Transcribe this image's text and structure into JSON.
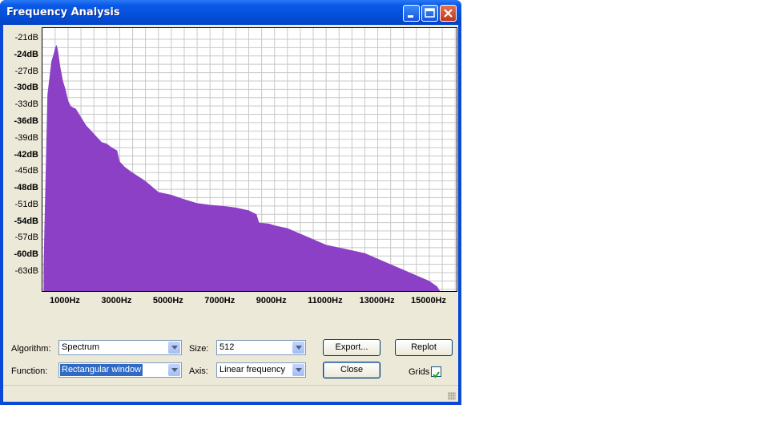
{
  "window": {
    "title": "Frequency Analysis"
  },
  "chart_data": {
    "type": "area",
    "color": "#8b40c6",
    "xlabel_ticks": [
      "1000Hz",
      "3000Hz",
      "5000Hz",
      "7000Hz",
      "9000Hz",
      "11000Hz",
      "13000Hz",
      "15000Hz"
    ],
    "ylabel_ticks": [
      "-21dB",
      "-24dB",
      "-27dB",
      "-30dB",
      "-33dB",
      "-36dB",
      "-39dB",
      "-42dB",
      "-45dB",
      "-48dB",
      "-51dB",
      "-54dB",
      "-57dB",
      "-60dB",
      "-63dB"
    ],
    "x_range_hz": [
      0,
      16000
    ],
    "y_range_db": [
      -67,
      -20
    ],
    "grid": true,
    "x": [
      50,
      200,
      350,
      450,
      500,
      550,
      600,
      700,
      800,
      900,
      1000,
      1100,
      1200,
      1300,
      1500,
      1700,
      1900,
      2100,
      2300,
      2500,
      2700,
      2900,
      3000,
      3200,
      3500,
      4000,
      4500,
      5000,
      5500,
      6000,
      6500,
      7000,
      7500,
      8000,
      8300,
      8400,
      8800,
      9000,
      9500,
      10000,
      10500,
      11000,
      11500,
      12000,
      12500,
      13000,
      13500,
      14000,
      14500,
      15000,
      15300,
      15500
    ],
    "y": [
      -62,
      -31,
      -25,
      -23.5,
      -22.5,
      -22,
      -22.8,
      -26,
      -28.5,
      -30,
      -32,
      -33,
      -33.3,
      -33.5,
      -35,
      -36.5,
      -37.5,
      -38.5,
      -39.5,
      -39.8,
      -40.5,
      -41,
      -43,
      -44,
      -45,
      -46.5,
      -48.5,
      -49,
      -49.8,
      -50.5,
      -50.8,
      -51,
      -51.3,
      -51.8,
      -52.5,
      -54,
      -54.2,
      -54.5,
      -55,
      -56,
      -57,
      -58,
      -58.5,
      -59,
      -59.5,
      -60.5,
      -61.5,
      -62.5,
      -63.5,
      -64.5,
      -65.5,
      -67
    ]
  },
  "controls": {
    "algorithm_label": "Algorithm:",
    "algorithm_value": "Spectrum",
    "function_label": "Function:",
    "function_value": "Rectangular window",
    "size_label": "Size:",
    "size_value": "512",
    "axis_label": "Axis:",
    "axis_value": "Linear frequency",
    "export_label": "Export...",
    "close_label": "Close",
    "replot_label": "Replot",
    "grids_label": "Grids",
    "grids_checked": true
  }
}
